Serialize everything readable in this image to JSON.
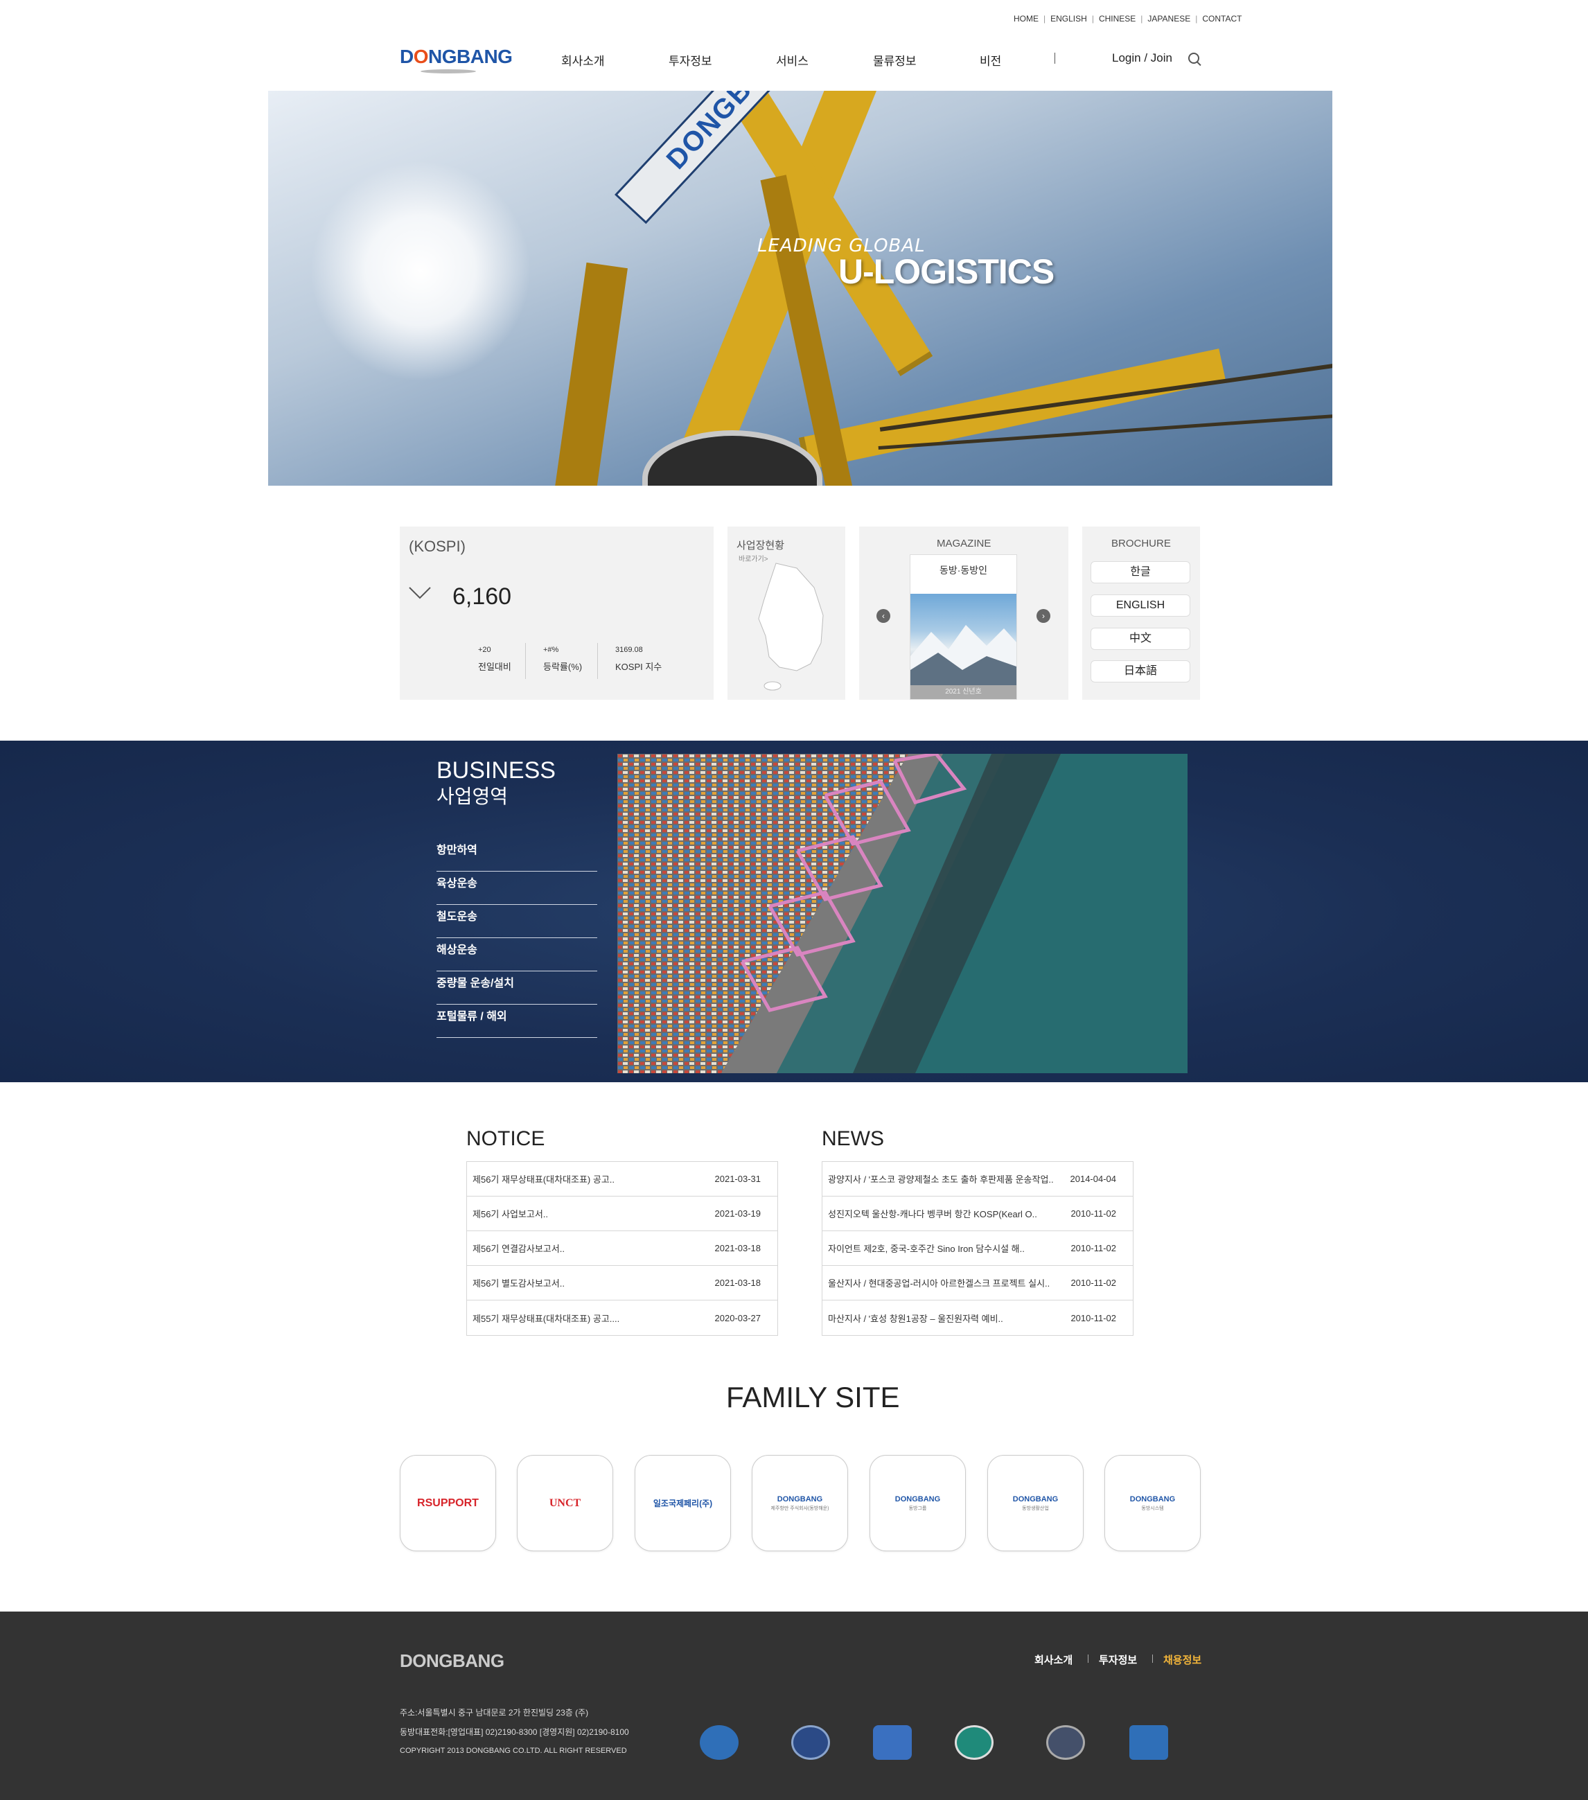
{
  "util_nav": [
    "HOME",
    "ENGLISH",
    "CHINESE",
    "JAPANESE",
    "CONTACT"
  ],
  "logo": {
    "text_before": "D",
    "text_o": "O",
    "text_after": "NGBANG"
  },
  "gnb": [
    "회사소개",
    "투자정보",
    "서비스",
    "물류정보",
    "비전"
  ],
  "login": "Login / Join",
  "hero": {
    "line1": "LEADING GLOBAL",
    "line2": "U-LOGISTICS",
    "banner": "DONGBANG"
  },
  "kospi": {
    "title": "(KOSPI)",
    "value": "6,160",
    "stats": [
      {
        "n": "+20",
        "l": "전일대비"
      },
      {
        "n": "+#%",
        "l": "등락률(%)"
      },
      {
        "n": "3169.08",
        "l": "KOSPI 지수"
      }
    ]
  },
  "business_map": {
    "title": "사업장현황",
    "sub": "바로가기>"
  },
  "magazine": {
    "title": "MAGAZINE",
    "book_title": "동방·동방인",
    "book_caption": "2021 신년호"
  },
  "brochure": {
    "title": "BROCHURE",
    "items": [
      "한글",
      "ENGLISH",
      "中文",
      "日本語"
    ]
  },
  "business": {
    "title_en": "BUSINESS",
    "title_ko": "사업영역",
    "items": [
      "항만하역",
      "육상운송",
      "철도운송",
      "해상운송",
      "중량물 운송/설치",
      "포털물류 / 해외"
    ]
  },
  "notice": {
    "title": "NOTICE",
    "rows": [
      {
        "t": "제56기 재무상태표(대차대조표) 공고..",
        "d": "2021-03-31"
      },
      {
        "t": "제56기 사업보고서..",
        "d": "2021-03-19"
      },
      {
        "t": "제56기 연결감사보고서..",
        "d": "2021-03-18"
      },
      {
        "t": "제56기 별도감사보고서..",
        "d": "2021-03-18"
      },
      {
        "t": "제55기 재무상태표(대차대조표) 공고....",
        "d": "2020-03-27"
      }
    ]
  },
  "news": {
    "title": "NEWS",
    "rows": [
      {
        "t": "광양지사 / '포스코 광양제철소 초도 출하 후판제품 운송작업..",
        "d": "2014-04-04"
      },
      {
        "t": "성진지오텍 울산항-캐나다 벵쿠버 항간 KOSP(Kearl O..",
        "d": "2010-11-02"
      },
      {
        "t": "자이언트 제2호, 중국-호주간 Sino Iron 담수시설 해..",
        "d": "2010-11-02"
      },
      {
        "t": "울산지사 / 현대중공업-러시아 아르한겔스크 프로젝트 실시..",
        "d": "2010-11-02"
      },
      {
        "t": "마산지사 / '효성 창원1공장 – 울진원자력 예비..",
        "d": "2010-11-02"
      }
    ]
  },
  "family": {
    "title": "FAMILY SITE",
    "sites": [
      {
        "name": "RSUPPORT",
        "color": "#d7242a",
        "sub": ""
      },
      {
        "name": "UNCT",
        "color": "#d7242a",
        "sub": ""
      },
      {
        "name": "일조국제페리(주)",
        "color": "#1f55a7",
        "sub": ""
      },
      {
        "name": "DONGBANG",
        "color": "#1f55a7",
        "sub": "제주항만 주식회사(동방해운)"
      },
      {
        "name": "DONGBANG",
        "color": "#1f55a7",
        "sub": "동방그룹"
      },
      {
        "name": "DONGBANG",
        "color": "#1f55a7",
        "sub": "동방생활산업"
      },
      {
        "name": "DONGBANG",
        "color": "#1f55a7",
        "sub": "동방시스템"
      }
    ]
  },
  "footer": {
    "logo": "DONGBANG",
    "menu": [
      "회사소개",
      "투자정보",
      "채용정보"
    ],
    "address": "주소:서울특별시 중구 남대문로 2가 한진빌딩 23층 (주)",
    "phone": "동방대표전화:[영업대표] 02)2190-8300 [경영지원] 02)2190-8100",
    "copyright": "COPYRIGHT 2013 DONGBANG CO.LTD. ALL RIGHT RESERVED",
    "partner_colors": [
      "#2f6fb8",
      "#2b4a86",
      "#3a70c0",
      "#1f8a7a",
      "#44506a",
      "#2f6fb8"
    ]
  },
  "colors": {
    "brand_blue": "#1f55a7",
    "brand_orange": "#e94e1b",
    "business_bg": "#1b2f55",
    "footer_bg": "#333333",
    "footer_accent": "#f2b53a"
  }
}
